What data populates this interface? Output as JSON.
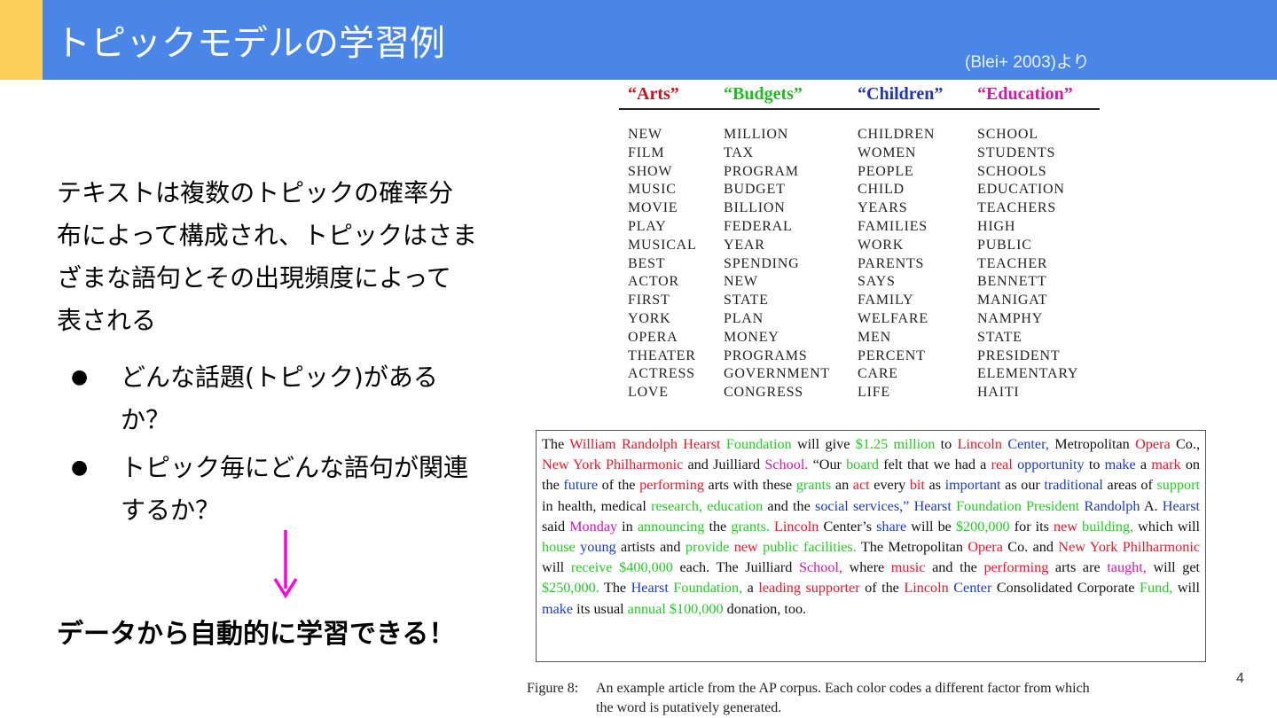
{
  "slide": {
    "title": "トピックモデルの学習例",
    "citation": "(Blei+ 2003)より",
    "page_number": "4",
    "colors": {
      "header": "#4a86e8",
      "accent": "#fbcf5c",
      "arrow": "#ff00e0"
    }
  },
  "left": {
    "para_lines": [
      "テキストは複数のトピックの確率分",
      "布によって構成され、トピックはさま",
      "ざまな語句とその出現頻度によって",
      "表される"
    ],
    "bullets": [
      {
        "line1": "どんな話題(トピック)がある",
        "line2": "か？"
      },
      {
        "line1": "トピック毎にどんな語句が関連",
        "line2": "するか？"
      }
    ],
    "bullet_symbol": "●",
    "conclusion": "データから自動的に学習できる！"
  },
  "topics": [
    {
      "name": "“Arts”",
      "color": "#d0101e",
      "words": [
        "NEW",
        "FILM",
        "SHOW",
        "MUSIC",
        "MOVIE",
        "PLAY",
        "MUSICAL",
        "BEST",
        "ACTOR",
        "FIRST",
        "YORK",
        "OPERA",
        "THEATER",
        "ACTRESS",
        "LOVE"
      ]
    },
    {
      "name": "“Budgets”",
      "color": "#22bb22",
      "words": [
        "MILLION",
        "TAX",
        "PROGRAM",
        "BUDGET",
        "BILLION",
        "FEDERAL",
        "YEAR",
        "SPENDING",
        "NEW",
        "STATE",
        "PLAN",
        "MONEY",
        "PROGRAMS",
        "GOVERNMENT",
        "CONGRESS"
      ]
    },
    {
      "name": "“Children”",
      "color": "#2233bb",
      "words": [
        "CHILDREN",
        "WOMEN",
        "PEOPLE",
        "CHILD",
        "YEARS",
        "FAMILIES",
        "WORK",
        "PARENTS",
        "SAYS",
        "FAMILY",
        "WELFARE",
        "MEN",
        "PERCENT",
        "CARE",
        "LIFE"
      ]
    },
    {
      "name": "“Education”",
      "color": "#d01aa6",
      "words": [
        "SCHOOL",
        "STUDENTS",
        "SCHOOLS",
        "EDUCATION",
        "TEACHERS",
        "HIGH",
        "PUBLIC",
        "TEACHER",
        "BENNETT",
        "MANIGAT",
        "NAMPHY",
        "STATE",
        "PRESIDENT",
        "ELEMENTARY",
        "HAITI"
      ]
    }
  ],
  "article_tokens": [
    [
      "The ",
      ""
    ],
    [
      "William Randolph Hearst",
      "ar"
    ],
    [
      " ",
      ""
    ],
    [
      "Foundation",
      "ag"
    ],
    [
      " will give ",
      ""
    ],
    [
      "$1.25 million",
      "ag"
    ],
    [
      " to ",
      ""
    ],
    [
      "Lincoln",
      "ar"
    ],
    [
      " ",
      ""
    ],
    [
      "Center,",
      "ab"
    ],
    [
      " Metropolitan ",
      ""
    ],
    [
      "Opera",
      "ar"
    ],
    [
      " Co., ",
      ""
    ],
    [
      "New York Philharmonic",
      "ar"
    ],
    [
      " and Juilliard ",
      ""
    ],
    [
      "School.",
      "am"
    ],
    [
      " “Our ",
      ""
    ],
    [
      "board",
      "ag"
    ],
    [
      " felt that we had a ",
      ""
    ],
    [
      "real",
      "ar"
    ],
    [
      " ",
      ""
    ],
    [
      "opportunity",
      "ab"
    ],
    [
      " to ",
      ""
    ],
    [
      "make",
      "ab"
    ],
    [
      " a ",
      ""
    ],
    [
      "mark",
      "ar"
    ],
    [
      " on the ",
      ""
    ],
    [
      "future",
      "ab"
    ],
    [
      " of the ",
      ""
    ],
    [
      "performing",
      "ar"
    ],
    [
      " arts with these ",
      ""
    ],
    [
      "grants",
      "ag"
    ],
    [
      " an ",
      ""
    ],
    [
      "act",
      "ar"
    ],
    [
      " every ",
      ""
    ],
    [
      "bit",
      "ar"
    ],
    [
      " as ",
      ""
    ],
    [
      "important",
      "ab"
    ],
    [
      " as our ",
      ""
    ],
    [
      "traditional",
      "ab"
    ],
    [
      " areas of ",
      ""
    ],
    [
      "support",
      "ag"
    ],
    [
      " in health, medical ",
      ""
    ],
    [
      "research, education",
      "ag"
    ],
    [
      " and the ",
      ""
    ],
    [
      "social services,”",
      "ab"
    ],
    [
      " ",
      ""
    ],
    [
      "Hearst",
      "ab"
    ],
    [
      " ",
      ""
    ],
    [
      "Foundation President",
      "ag"
    ],
    [
      " ",
      ""
    ],
    [
      "Randolph",
      "ab"
    ],
    [
      " A. ",
      ""
    ],
    [
      "Hearst",
      "ab"
    ],
    [
      " said ",
      ""
    ],
    [
      "Monday",
      "am"
    ],
    [
      " in ",
      ""
    ],
    [
      "announcing",
      "ag"
    ],
    [
      " the ",
      ""
    ],
    [
      "grants.",
      "ag"
    ],
    [
      " ",
      ""
    ],
    [
      "Lincoln",
      "ar"
    ],
    [
      " Center’s ",
      ""
    ],
    [
      "share",
      "ab"
    ],
    [
      " will be ",
      ""
    ],
    [
      "$200,000",
      "ag"
    ],
    [
      " for its ",
      ""
    ],
    [
      "new",
      "ar"
    ],
    [
      " ",
      ""
    ],
    [
      "building,",
      "ag"
    ],
    [
      " which will ",
      ""
    ],
    [
      "house",
      "ag"
    ],
    [
      " ",
      ""
    ],
    [
      "young",
      "ab"
    ],
    [
      " artists and ",
      ""
    ],
    [
      "provide",
      "ag"
    ],
    [
      " ",
      ""
    ],
    [
      "new",
      "ar"
    ],
    [
      " ",
      ""
    ],
    [
      "public facilities.",
      "ag"
    ],
    [
      " The Metropolitan ",
      ""
    ],
    [
      "Opera",
      "ar"
    ],
    [
      " Co. and ",
      ""
    ],
    [
      "New York Philharmonic",
      "ar"
    ],
    [
      " will ",
      ""
    ],
    [
      "receive",
      "ag"
    ],
    [
      " ",
      ""
    ],
    [
      "$400,000",
      "ag"
    ],
    [
      " each. The Juilliard ",
      ""
    ],
    [
      "School,",
      "am"
    ],
    [
      " where ",
      ""
    ],
    [
      "music",
      "ar"
    ],
    [
      " and the ",
      ""
    ],
    [
      "performing",
      "ar"
    ],
    [
      " arts are ",
      ""
    ],
    [
      "taught,",
      "am"
    ],
    [
      " will get ",
      ""
    ],
    [
      "$250,000.",
      "ag"
    ],
    [
      " The ",
      ""
    ],
    [
      "Hearst",
      "ab"
    ],
    [
      " ",
      ""
    ],
    [
      "Foundation,",
      "ag"
    ],
    [
      " a ",
      ""
    ],
    [
      "leading",
      "ar"
    ],
    [
      " ",
      ""
    ],
    [
      "supporter",
      "ar"
    ],
    [
      " of the ",
      ""
    ],
    [
      "Lincoln",
      "ar"
    ],
    [
      " ",
      ""
    ],
    [
      "Center",
      "ab"
    ],
    [
      " Consolidated Corporate ",
      ""
    ],
    [
      "Fund,",
      "ag"
    ],
    [
      " will ",
      ""
    ],
    [
      "make",
      "ab"
    ],
    [
      " its usual ",
      ""
    ],
    [
      "annual",
      "ag"
    ],
    [
      " ",
      ""
    ],
    [
      "$100,000",
      "ag"
    ],
    [
      " donation, too.",
      ""
    ]
  ],
  "caption": {
    "label": "Figure 8:",
    "line1": "An example article from the AP corpus. Each color codes a different factor from which",
    "line2": "the word is putatively generated."
  }
}
